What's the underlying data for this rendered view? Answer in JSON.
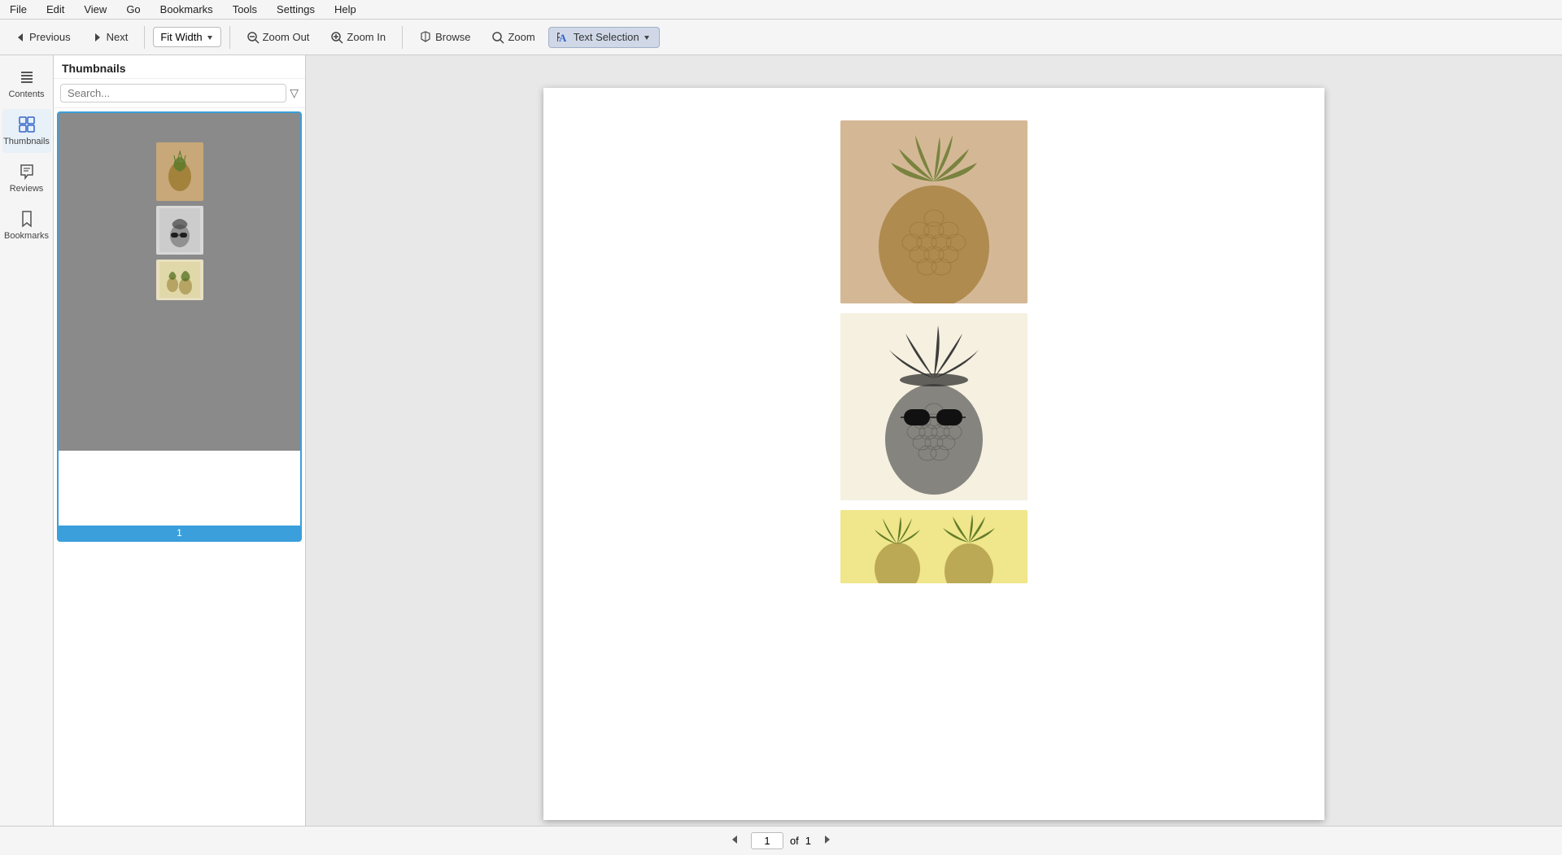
{
  "menu": {
    "items": [
      "File",
      "Edit",
      "View",
      "Go",
      "Bookmarks",
      "Tools",
      "Settings",
      "Help"
    ]
  },
  "toolbar": {
    "previous_label": "Previous",
    "next_label": "Next",
    "fit_width_label": "Fit Width",
    "zoom_out_label": "Zoom Out",
    "zoom_in_label": "Zoom In",
    "browse_label": "Browse",
    "zoom_label": "Zoom",
    "text_selection_label": "Text Selection"
  },
  "sidebar": {
    "contents_label": "Contents",
    "thumbnails_label": "Thumbnails",
    "reviews_label": "Reviews",
    "bookmarks_label": "Bookmarks"
  },
  "thumbnails_panel": {
    "title": "Thumbnails",
    "search_placeholder": "Search...",
    "page_number": "1"
  },
  "main": {
    "images": [
      {
        "alt": "pineapple-top-sepia",
        "type": "sepia"
      },
      {
        "alt": "pineapple-sunglasses-bw",
        "type": "bw"
      },
      {
        "alt": "pineapple-small-yellow",
        "type": "yellow"
      }
    ]
  },
  "bottom_nav": {
    "page_current": "1",
    "page_of": "of",
    "page_total": "1"
  }
}
